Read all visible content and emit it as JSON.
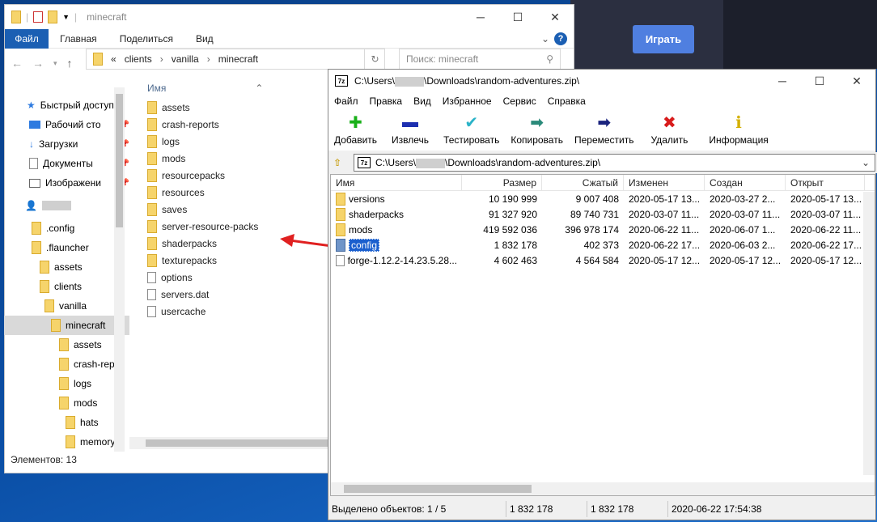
{
  "launcher": {
    "play_label": "Играть"
  },
  "explorer": {
    "title": "minecraft",
    "ribbon": {
      "file": "Файл",
      "tabs": [
        "Главная",
        "Поделиться",
        "Вид"
      ]
    },
    "path": {
      "prefix": "«",
      "parts": [
        "clients",
        "vanilla",
        "minecraft"
      ]
    },
    "search_placeholder": "Поиск: minecraft",
    "nav": [
      {
        "label": "Быстрый доступ",
        "pin": false
      },
      {
        "label": "Рабочий сто",
        "pin": true
      },
      {
        "label": "Загрузки",
        "pin": true
      },
      {
        "label": "Документы",
        "pin": true
      },
      {
        "label": "Изображени",
        "pin": true
      },
      {
        "label": ".config"
      },
      {
        "label": ".flauncher"
      },
      {
        "label": "assets"
      },
      {
        "label": "clients"
      },
      {
        "label": "vanilla"
      },
      {
        "label": "minecraft"
      },
      {
        "label": "assets"
      },
      {
        "label": "crash-repo"
      },
      {
        "label": "logs"
      },
      {
        "label": "mods"
      },
      {
        "label": "hats"
      },
      {
        "label": "memory"
      }
    ],
    "column_name": "Имя",
    "files": [
      "assets",
      "crash-reports",
      "logs",
      "mods",
      "resourcepacks",
      "resources",
      "saves",
      "server-resource-packs",
      "shaderpacks",
      "texturepacks",
      "options",
      "servers.dat",
      "usercache"
    ],
    "status": "Элементов: 13"
  },
  "zip": {
    "title": "C:\\Users\\",
    "title_suffix": "\\Downloads\\random-adventures.zip\\",
    "menu": [
      "Файл",
      "Правка",
      "Вид",
      "Избранное",
      "Сервис",
      "Справка"
    ],
    "toolbar": [
      "Добавить",
      "Извлечь",
      "Тестировать",
      "Копировать",
      "Переместить",
      "Удалить",
      "Информация"
    ],
    "address_prefix": "C:\\Users\\",
    "address_suffix": "\\Downloads\\random-adventures.zip\\",
    "columns": [
      "Имя",
      "Размер",
      "Сжатый",
      "Изменен",
      "Создан",
      "Открыт"
    ],
    "rows": [
      {
        "name": "versions",
        "size": "10 190 999",
        "packed": "9 007 408",
        "modified": "2020-05-17 13...",
        "created": "2020-03-27 2...",
        "accessed": "2020-05-17 13..."
      },
      {
        "name": "shaderpacks",
        "size": "91 327 920",
        "packed": "89 740 731",
        "modified": "2020-03-07 11...",
        "created": "2020-03-07 11...",
        "accessed": "2020-03-07 11..."
      },
      {
        "name": "mods",
        "size": "419 592 036",
        "packed": "396 978 174",
        "modified": "2020-06-22 11...",
        "created": "2020-06-07 1...",
        "accessed": "2020-06-22 11..."
      },
      {
        "name": "config",
        "size": "1 832 178",
        "packed": "402 373",
        "modified": "2020-06-22 17...",
        "created": "2020-06-03 2...",
        "accessed": "2020-06-22 17..."
      },
      {
        "name": "forge-1.12.2-14.23.5.28...",
        "size": "4 602 463",
        "packed": "4 564 584",
        "modified": "2020-05-17 12...",
        "created": "2020-05-17 12...",
        "accessed": "2020-05-17 12..."
      }
    ],
    "status": [
      "Выделено объектов: 1 / 5",
      "1 832 178",
      "1 832 178",
      "2020-06-22 17:54:38"
    ]
  }
}
